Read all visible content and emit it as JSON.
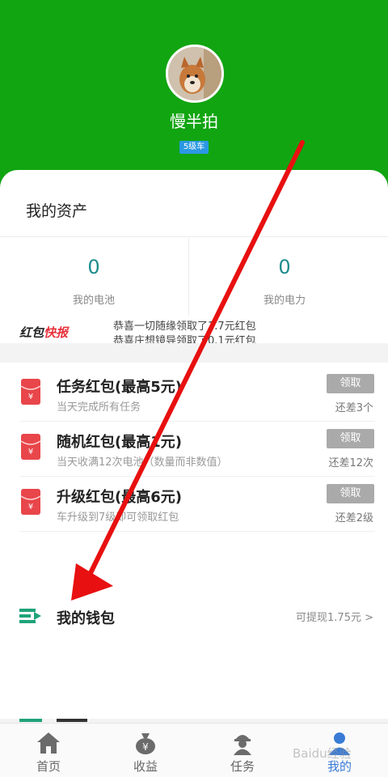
{
  "profile": {
    "nickname": "慢半拍",
    "level": "5级车"
  },
  "assets": {
    "title": "我的资产",
    "battery": {
      "value": "0",
      "label": "我的电池"
    },
    "power": {
      "value": "0",
      "label": "我的电力"
    }
  },
  "ticker": {
    "logo_part1": "红包",
    "logo_part2": "快报",
    "line1": "恭喜一切随缘领取了1.7元红包",
    "line2": "恭喜庄想镜导领取了0.1元红包"
  },
  "red_packets": [
    {
      "title": "任务红包(最高5元)",
      "subtitle": "当天完成所有任务",
      "button": "领取",
      "remaining": "还差3个"
    },
    {
      "title": "随机红包(最高1元)",
      "subtitle": "当天收满12次电池（数量而非数值）",
      "button": "领取",
      "remaining": "还差12次"
    },
    {
      "title": "升级红包(最高6元)",
      "subtitle": "车升级到7级即可领取红包",
      "button": "领取",
      "remaining": "还差2级"
    }
  ],
  "wallet": {
    "title": "我的钱包",
    "withdrawable": "可提现1.75元 >"
  },
  "tabs": [
    {
      "label": "首页",
      "icon": "home-icon"
    },
    {
      "label": "收益",
      "icon": "money-bag-icon"
    },
    {
      "label": "任务",
      "icon": "worker-icon"
    },
    {
      "label": "我的",
      "icon": "user-icon"
    }
  ],
  "watermark": "Baidu经验",
  "colors": {
    "header_green": "#11a511",
    "stat_teal": "#1b8c8c",
    "red_packet": "#e8464a",
    "arrow_red": "#e81010",
    "tab_active": "#3a7bd5"
  }
}
